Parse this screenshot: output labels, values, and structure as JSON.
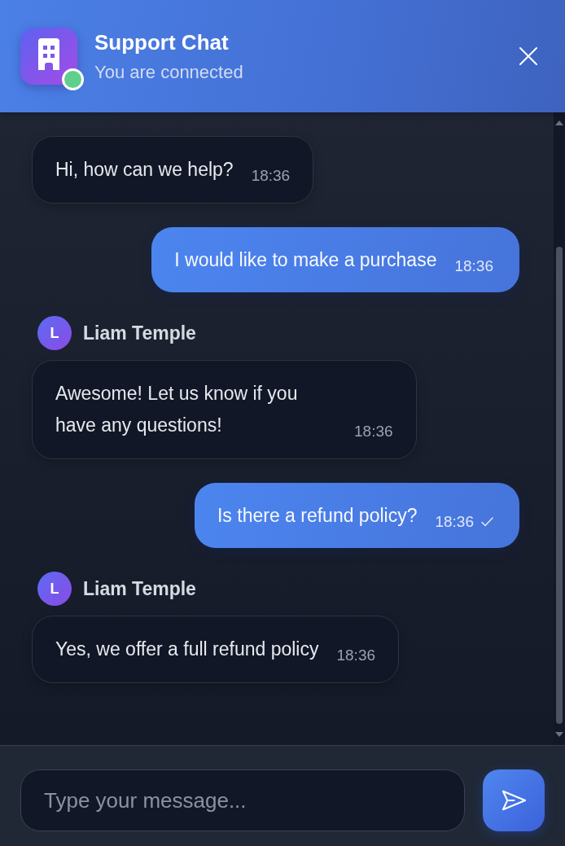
{
  "header": {
    "title": "Support Chat",
    "status": "You are connected",
    "online": true
  },
  "messages": [
    {
      "kind": "agent",
      "text": "Hi, how can we help?",
      "time": "18:36"
    },
    {
      "kind": "user",
      "text": "I would like to make a purchase",
      "time": "18:36",
      "read": false
    },
    {
      "kind": "agent",
      "sender": "Liam Temple",
      "avatar": "L",
      "text": "Awesome! Let us know if you have any questions!",
      "time": "18:36"
    },
    {
      "kind": "user",
      "text": "Is there a refund policy?",
      "time": "18:36",
      "read": true
    },
    {
      "kind": "agent",
      "sender": "Liam Temple",
      "avatar": "L",
      "text": "Yes, we offer a full refund policy",
      "time": "18:36"
    }
  ],
  "composer": {
    "placeholder": "Type your message..."
  }
}
